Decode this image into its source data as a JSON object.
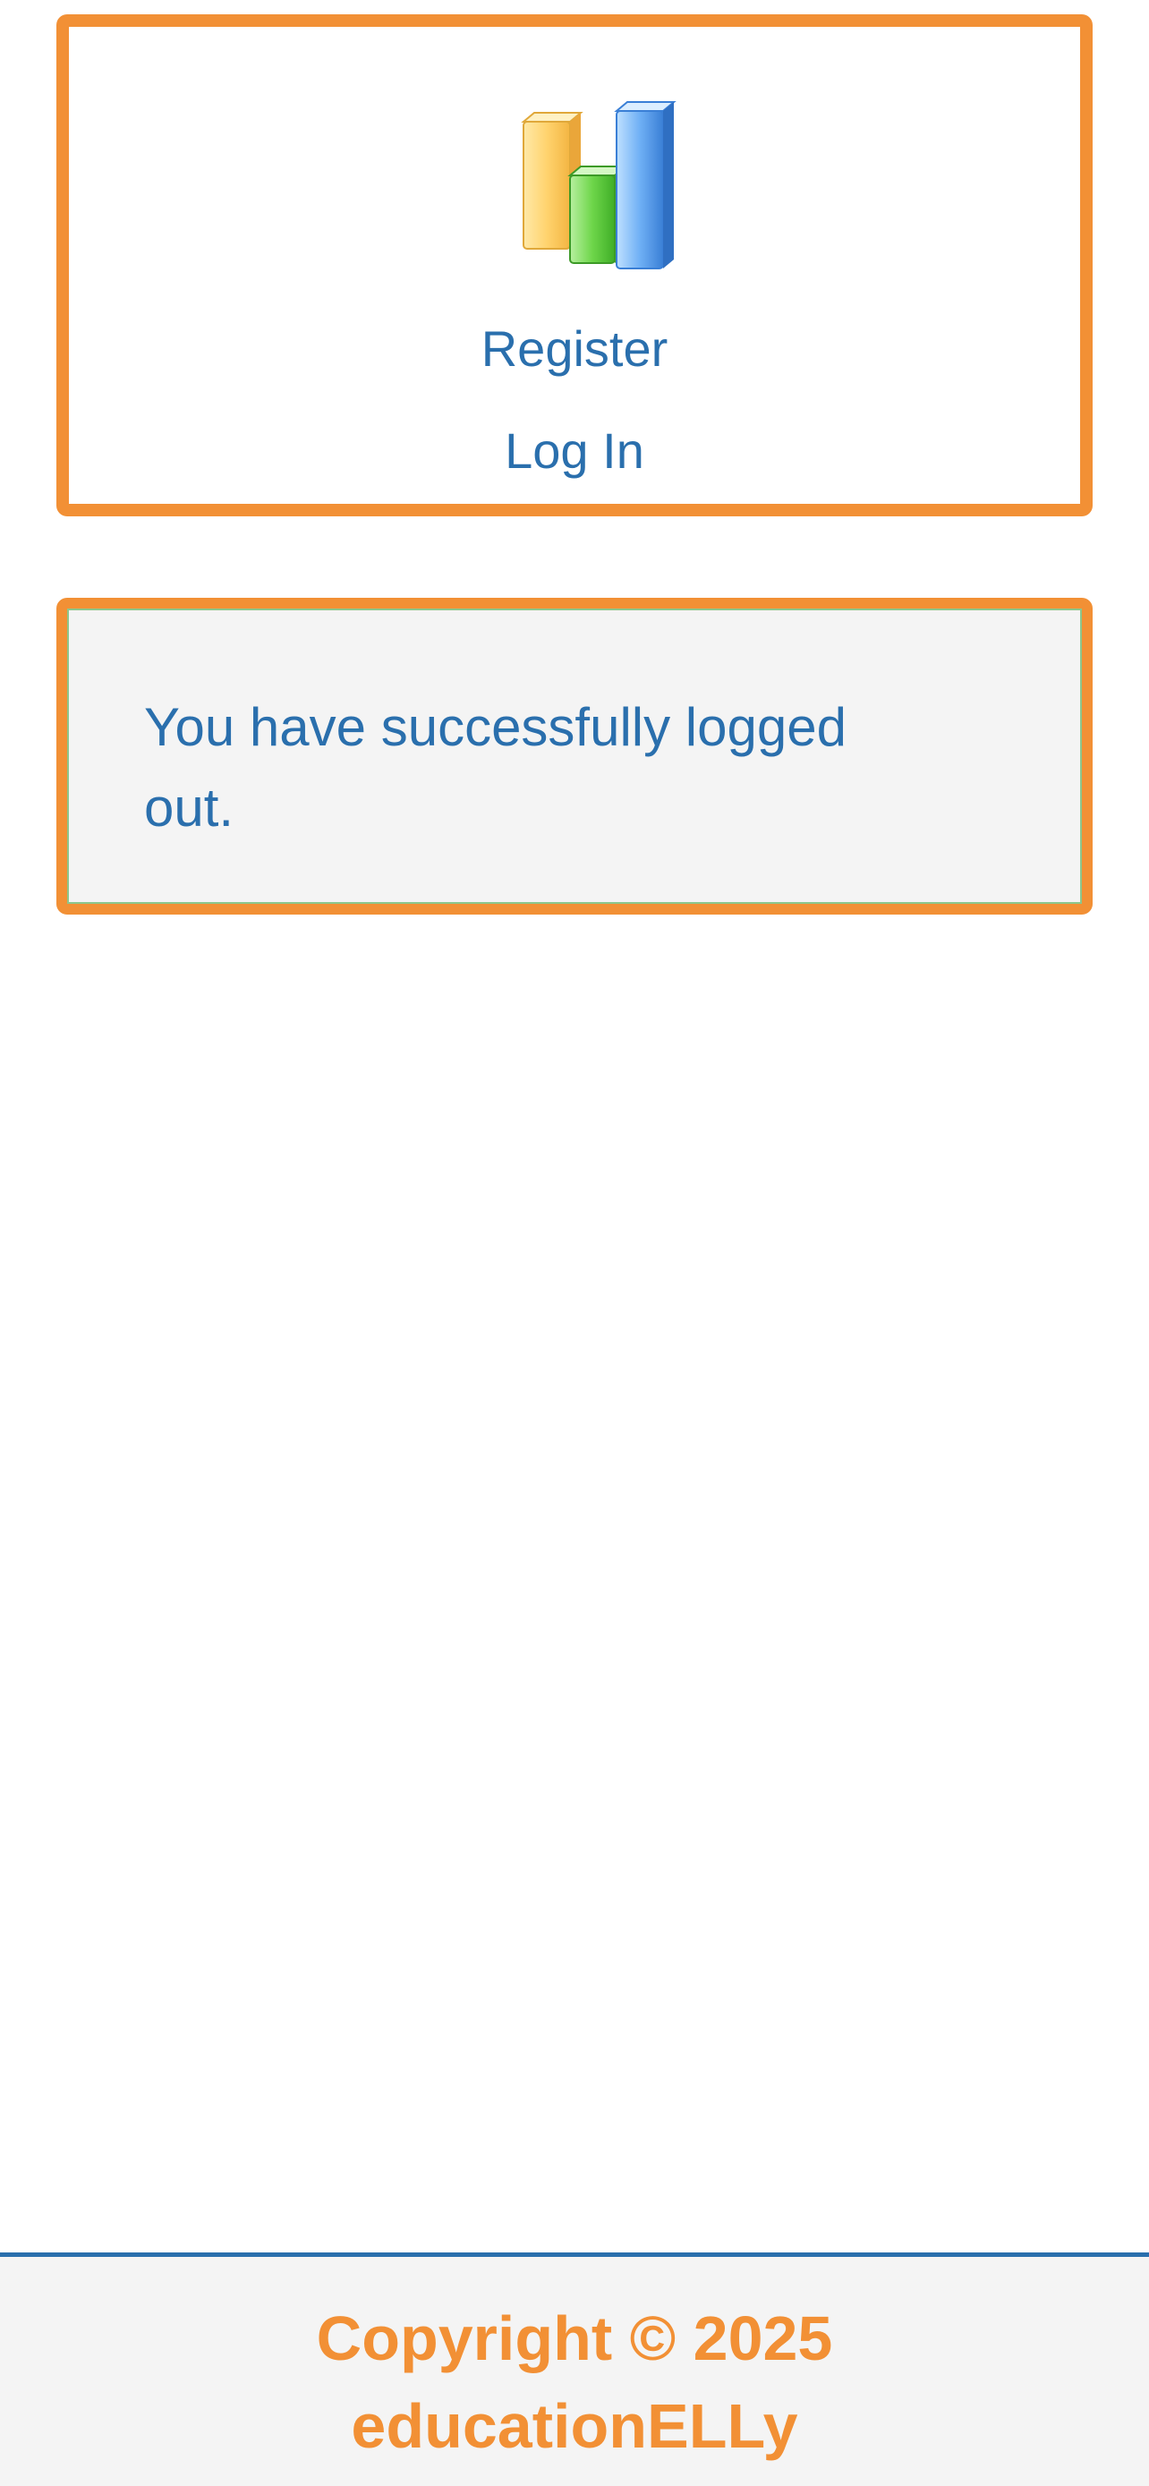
{
  "nav": {
    "register_label": "Register",
    "login_label": "Log In",
    "logo_icon": "bar-chart-logo-icon"
  },
  "message": {
    "text": "You have successfully logged out."
  },
  "footer": {
    "line1": "Copyright © 2025",
    "line2": "educationELLy"
  },
  "colors": {
    "accent_orange": "#f29035",
    "link_blue": "#2a6fad",
    "panel_gray": "#f4f4f4",
    "success_border": "#8cc68c"
  }
}
